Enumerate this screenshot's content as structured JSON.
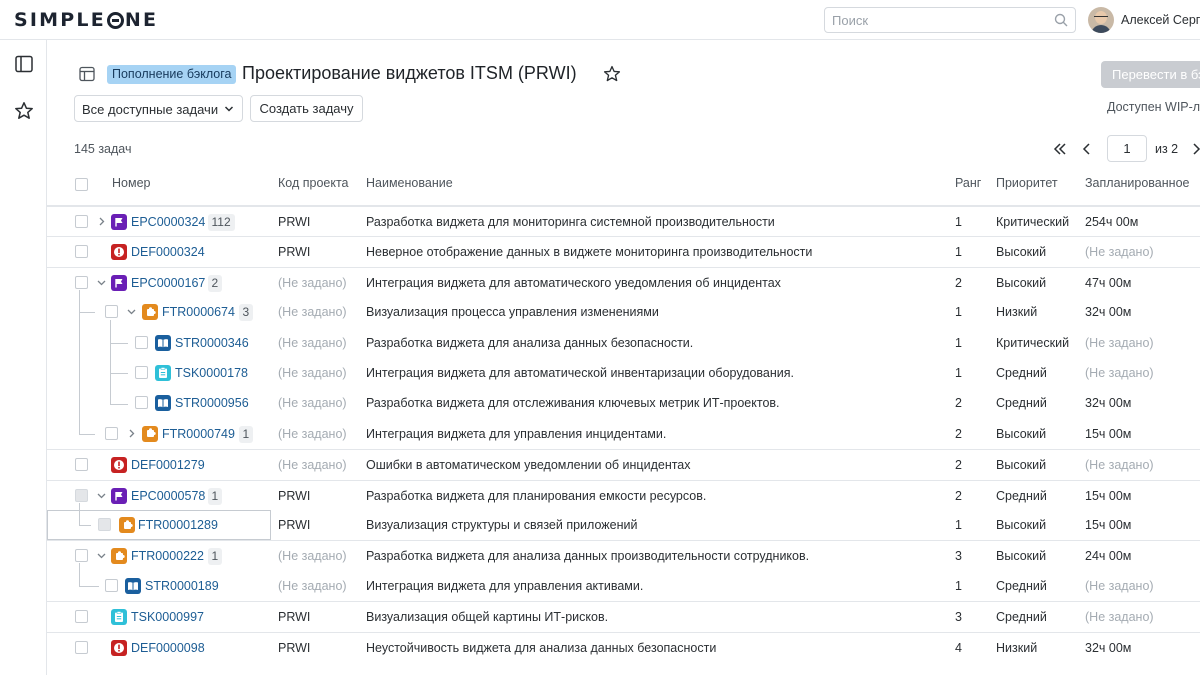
{
  "brand": {
    "logo_text": "SIMPLEONE"
  },
  "topbar": {
    "search_placeholder": "Поиск",
    "username": "Алексей Серг"
  },
  "header": {
    "badge": "Пополнение бэклога",
    "title": "Проектирование виджетов ITSM (PRWI)",
    "primary_button": "Перевести в бэ",
    "wip_text": "Доступен WIP-ли"
  },
  "toolbar": {
    "filter_value": "Все доступные задачи",
    "create_button": "Создать задачу"
  },
  "summary": {
    "count": "145 задач"
  },
  "pagination": {
    "current": "1",
    "of_text": "из 2"
  },
  "columns": {
    "number": "Номер",
    "project_code": "Код проекта",
    "name": "Наименование",
    "rank": "Ранг",
    "priority": "Приоритет",
    "planned": "Запланированное"
  },
  "type_colors": {
    "epic": "#6a1fb5",
    "defect": "#c62222",
    "feature": "#e38a1e",
    "story": "#1a5f9e",
    "task": "#2fc0d8"
  },
  "rows": [
    {
      "type": "epic",
      "number": "EPC0000324",
      "count": "112",
      "code": "PRWI",
      "name": "Разработка виджета для мониторинга системной производительности",
      "rank": "1",
      "priority": "Критический",
      "planned": "254ч 00м"
    },
    {
      "type": "defect",
      "number": "DEF0000324",
      "count": "",
      "code": "PRWI",
      "name": "Неверное отображение данных в виджете мониторинга производительности",
      "rank": "1",
      "priority": "Высокий",
      "planned": "(Не задано)"
    },
    {
      "type": "epic",
      "number": "EPC0000167",
      "count": "2",
      "code": "(Не задано)",
      "name": "Интеграция виджета для автоматического уведомления об инцидентах",
      "rank": "2",
      "priority": "Высокий",
      "planned": "47ч 00м"
    },
    {
      "type": "feature",
      "number": "FTR0000674",
      "count": "3",
      "code": "(Не задано)",
      "name": "Визуализация процесса управления изменениями",
      "rank": "1",
      "priority": "Низкий",
      "planned": "32ч 00м"
    },
    {
      "type": "story",
      "number": "STR0000346",
      "count": "",
      "code": "(Не задано)",
      "name": "Разработка виджета для анализа данных безопасности.",
      "rank": "1",
      "priority": "Критический",
      "planned": "(Не задано)"
    },
    {
      "type": "task",
      "number": "TSK0000178",
      "count": "",
      "code": "(Не задано)",
      "name": "Интеграция виджета для автоматической инвентаризации оборудования.",
      "rank": "1",
      "priority": "Средний",
      "planned": "(Не задано)"
    },
    {
      "type": "story",
      "number": "STR0000956",
      "count": "",
      "code": "(Не задано)",
      "name": "Разработка виджета для отслеживания ключевых метрик ИТ-проектов.",
      "rank": "2",
      "priority": "Средний",
      "planned": "32ч 00м"
    },
    {
      "type": "feature",
      "number": "FTR0000749",
      "count": "1",
      "code": "(Не задано)",
      "name": "Интеграция виджета для управления инцидентами.",
      "rank": "2",
      "priority": "Высокий",
      "planned": "15ч 00м"
    },
    {
      "type": "defect",
      "number": "DEF0001279",
      "count": "",
      "code": "(Не задано)",
      "name": "Ошибки в автоматическом уведомлении об инцидентах",
      "rank": "2",
      "priority": "Высокий",
      "planned": "(Не задано)"
    },
    {
      "type": "epic",
      "number": "EPC0000578",
      "count": "1",
      "code": "PRWI",
      "name": "Разработка виджета для планирования емкости ресурсов.",
      "rank": "2",
      "priority": "Средний",
      "planned": "15ч 00м"
    },
    {
      "type": "feature",
      "number": "FTR00001289",
      "count": "",
      "code": "PRWI",
      "name": "Визуализация структуры и связей приложений",
      "rank": "1",
      "priority": "Высокий",
      "planned": "15ч 00м"
    },
    {
      "type": "feature",
      "number": "FTR0000222",
      "count": "1",
      "code": "(Не задано)",
      "name": "Разработка виджета для анализа данных производительности сотрудников.",
      "rank": "3",
      "priority": "Высокий",
      "planned": "24ч 00м"
    },
    {
      "type": "story",
      "number": "STR0000189",
      "count": "",
      "code": "(Не задано)",
      "name": "Интеграция виджета для управления активами.",
      "rank": "1",
      "priority": "Средний",
      "planned": "(Не задано)"
    },
    {
      "type": "task",
      "number": "TSK0000997",
      "count": "",
      "code": "PRWI",
      "name": "Визуализация общей картины ИТ-рисков.",
      "rank": "3",
      "priority": "Средний",
      "planned": "(Не задано)"
    },
    {
      "type": "defect",
      "number": "DEF0000098",
      "count": "",
      "code": "PRWI",
      "name": "Неустойчивость виджета для анализа данных безопасности",
      "rank": "4",
      "priority": "Низкий",
      "planned": "32ч 00м"
    }
  ]
}
